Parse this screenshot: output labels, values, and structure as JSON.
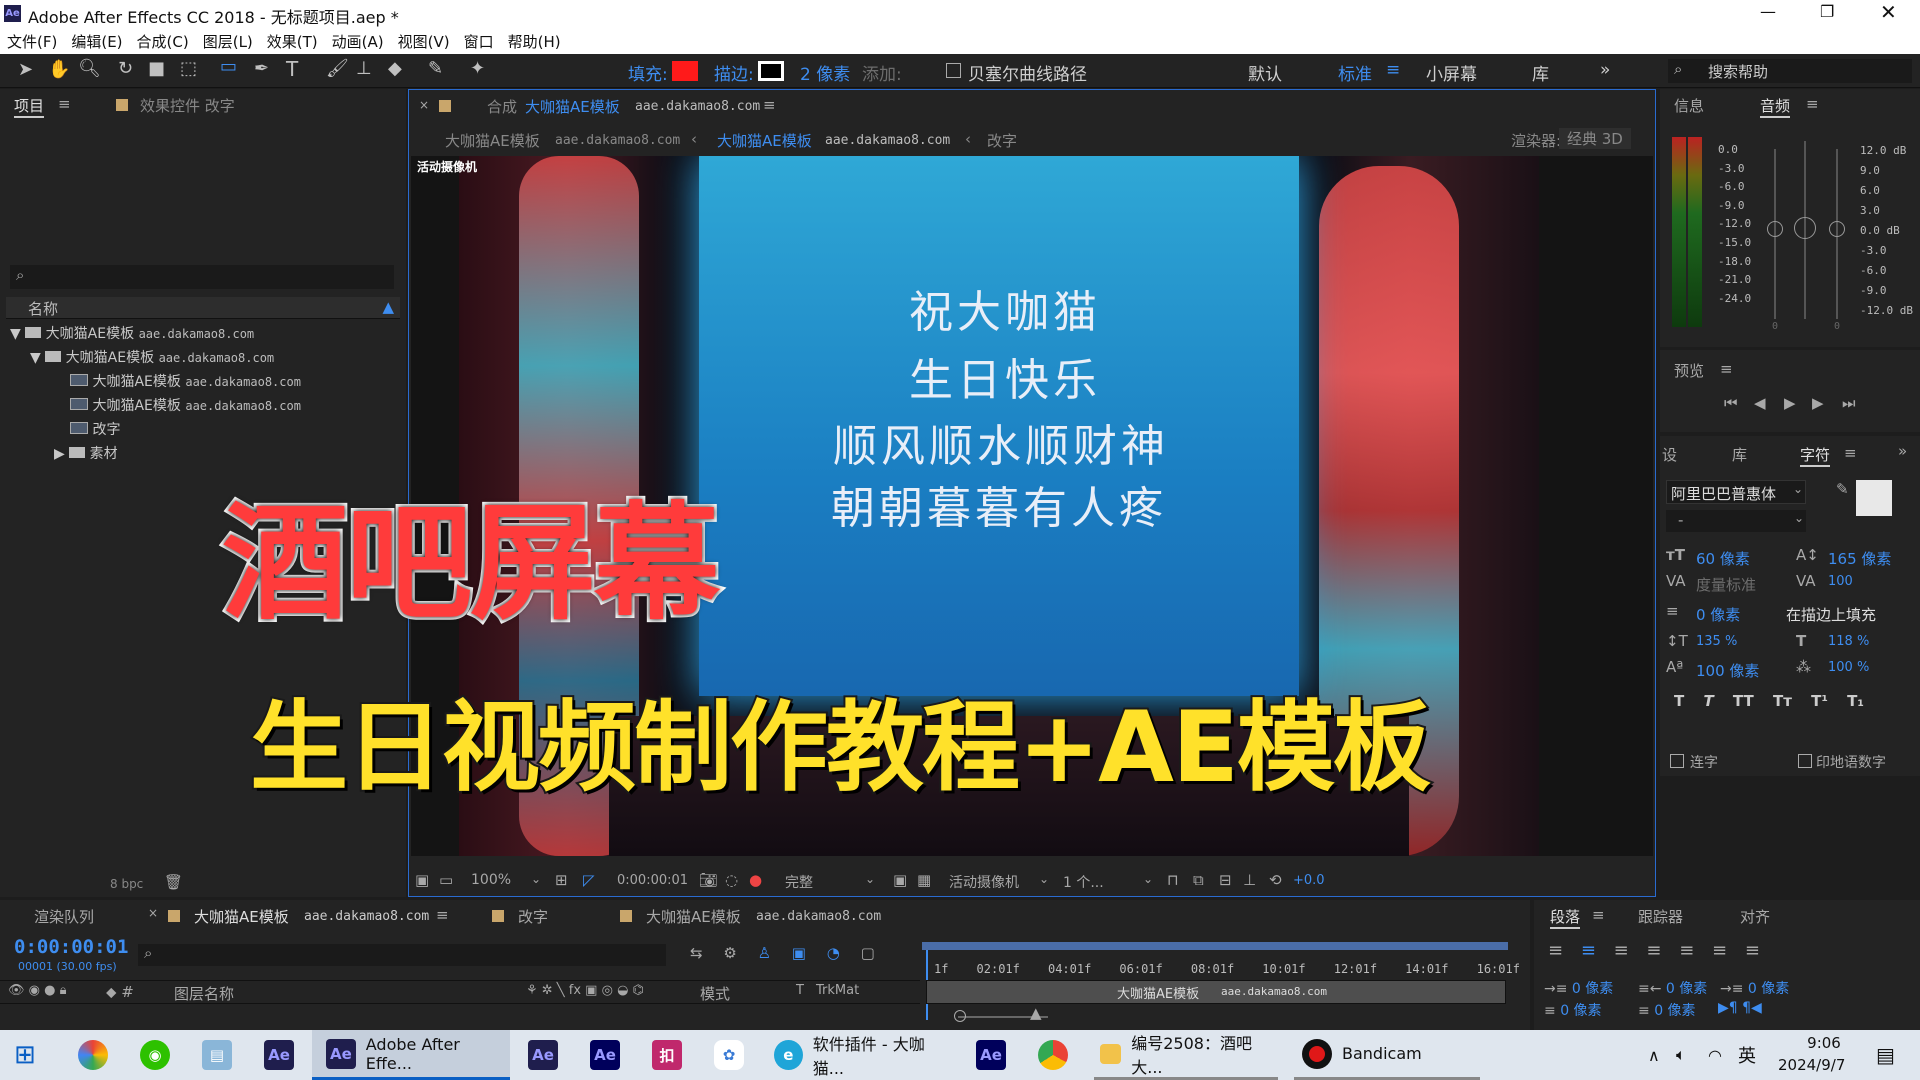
{
  "window": {
    "title": "Adobe After Effects CC 2018 - 无标题项目.aep *",
    "app_icon": "Ae"
  },
  "menu": [
    "文件(F)",
    "编辑(E)",
    "合成(C)",
    "图层(L)",
    "效果(T)",
    "动画(A)",
    "视图(V)",
    "窗口",
    "帮助(H)"
  ],
  "toolbar": {
    "fill_label": "填充:",
    "stroke_label": "描边:",
    "stroke_width": "2 像素",
    "add_label": "添加:",
    "bezier_label": "贝塞尔曲线路径",
    "workspaces": [
      "默认",
      "标准",
      "小屏幕",
      "库"
    ],
    "search_placeholder": "搜索帮助",
    "fill_color": "#ff1a1a"
  },
  "project": {
    "tab_project": "项目",
    "tab_effects": "效果控件 改字",
    "col_name": "名称",
    "tree": [
      {
        "label": "大咖猫AE模板",
        "url": "aae.dakamao8.com"
      },
      {
        "label": "大咖猫AE模板",
        "url": "aae.dakamao8.com"
      },
      {
        "label": "大咖猫AE模板",
        "url": "aae.dakamao8.com"
      },
      {
        "label": "大咖猫AE模板",
        "url": "aae.dakamao8.com"
      },
      {
        "label": "改字",
        "url": ""
      },
      {
        "label": "素材",
        "url": ""
      }
    ],
    "bpc": "8 bpc"
  },
  "comp": {
    "tab_prefix": "合成",
    "tab_name": "大咖猫AE模板",
    "tab_url": "aae.dakamao8.com",
    "crumbs": [
      {
        "name": "大咖猫AE模板",
        "url": "aae.dakamao8.com"
      },
      {
        "name": "大咖猫AE模板",
        "url": "aae.dakamao8.com"
      },
      {
        "name": "改字",
        "url": ""
      }
    ],
    "renderer_label": "渲染器:",
    "renderer": "经典 3D",
    "camera_label": "活动摄像机",
    "zoom": "100%",
    "timecode": "0:00:00:01",
    "quality": "完整",
    "view_camera": "活动摄像机",
    "views": "1 个...",
    "exposure": "+0.0"
  },
  "screen_text": [
    "祝大咖猫",
    "生日快乐",
    "顺风顺水顺财神",
    "朝朝暮暮有人疼"
  ],
  "overlay": {
    "line1": "酒吧屏幕",
    "line2": "生日视频制作教程+AE模板"
  },
  "info": {
    "tab_info": "信息",
    "tab_audio": "音频",
    "db_left": [
      "0.0",
      "-3.0",
      "-6.0",
      "-9.0",
      "-12.0",
      "-15.0",
      "-18.0",
      "-21.0",
      "-24.0"
    ],
    "db_right": [
      "12.0 dB",
      "9.0",
      "6.0",
      "3.0",
      "0.0 dB",
      "-3.0",
      "-6.0",
      "-9.0",
      "-12.0 dB"
    ],
    "zero_a": "0",
    "zero_b": "0"
  },
  "preview": {
    "title": "预览"
  },
  "char": {
    "tab_settings": "设",
    "tab_lib": "库",
    "tab_char": "字符",
    "font": "阿里巴巴普惠体",
    "style": "-",
    "size": "60 像素",
    "leading": "165 像素",
    "kerning": "度量标准",
    "tracking": "100",
    "stroke_w": "0 像素",
    "stroke_mode": "在描边上填充",
    "vscale": "135 %",
    "hscale": "118 %",
    "baseline": "100 像素",
    "tsume": "100 %",
    "ligature": "连字",
    "hindi": "印地语数字"
  },
  "timeline": {
    "tab_render": "渲染队列",
    "tab_comp": "大咖猫AE模板",
    "tab_comp_url": "aae.dakamao8.com",
    "tab_edit": "改字",
    "tab_comp2": "大咖猫AE模板",
    "tab_comp2_url": "aae.dakamao8.com",
    "timecode": "0:00:00:01",
    "frames": "00001 (30.00 fps)",
    "col_layer": "图层名称",
    "col_mode": "模式",
    "col_t": "T",
    "col_trk": "TrkMat",
    "ticks": [
      "1f",
      "02:01f",
      "04:01f",
      "06:01f",
      "08:01f",
      "10:01f",
      "12:01f",
      "14:01f",
      "16:01f"
    ],
    "bar_label": "大咖猫AE模板",
    "bar_url": "aae.dakamao8.com"
  },
  "para": {
    "tab_para": "段落",
    "tab_tracker": "跟踪器",
    "tab_align": "对齐",
    "v1": "0 像素",
    "v2": "0 像素",
    "v3": "0 像素",
    "v4": "0 像素",
    "v5": "0 像素"
  },
  "taskbar": {
    "items": [
      {
        "label": "Adobe After Effe..."
      },
      {
        "label": "软件插件 - 大咖猫..."
      },
      {
        "label": "编号2508：酒吧大..."
      },
      {
        "label": "Bandicam"
      }
    ],
    "ime": "英",
    "time": "9:06",
    "date": "2024/9/7"
  }
}
